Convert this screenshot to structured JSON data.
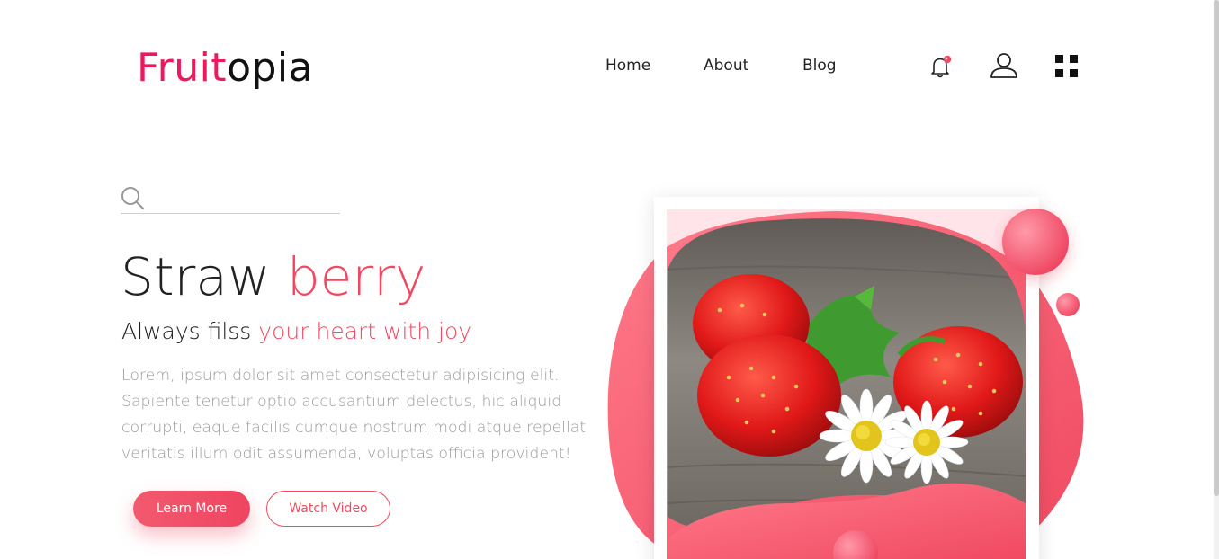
{
  "brand": {
    "logo_part1": "Fruit",
    "logo_part2": "opia",
    "accent_color": "#f0185c",
    "pink_color": "#f04a62"
  },
  "nav": {
    "items": [
      {
        "label": "Home"
      },
      {
        "label": "About"
      },
      {
        "label": "Blog"
      }
    ],
    "icons": [
      "bell-icon",
      "user-icon",
      "grid-menu-icon"
    ]
  },
  "search": {
    "placeholder": ""
  },
  "hero": {
    "title_part1": "Straw ",
    "title_part2": "berry",
    "subtitle_part1": "Always filss ",
    "subtitle_part2": "your heart with joy",
    "description": "Lorem, ipsum dolor sit amet consectetur adipisicing elit. Sapiente tenetur optio accusantium delectus, hic aliquid corrupti, eaque facilis cumque nostrum modi atque repellat veritatis illum odit assumenda, voluptas officia provident!",
    "primary_button": "Learn More",
    "secondary_button": "Watch Video"
  }
}
